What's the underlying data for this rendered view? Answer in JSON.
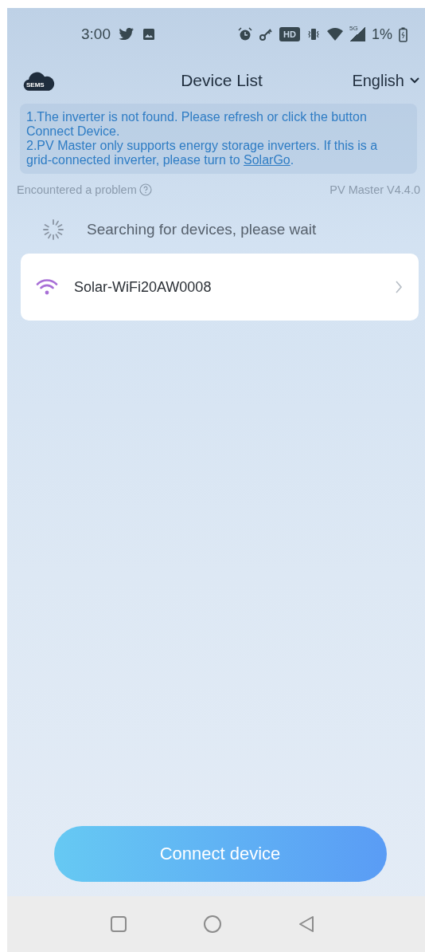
{
  "status_bar": {
    "time": "3:00",
    "hd_badge": "HD",
    "network": "5G",
    "battery": "1%"
  },
  "header": {
    "logo_text": "SEMS",
    "title": "Device List",
    "language": "English"
  },
  "notices": [
    {
      "text": "1.The inverter is not found. Please refresh or click the button Connect Device."
    },
    {
      "text": "2.PV Master only supports energy storage inverters. If this is a grid-connected inverter, please turn to ",
      "link": "SolarGo",
      "suffix": "."
    }
  ],
  "problem_link": "Encountered a problem",
  "version": "PV Master V4.4.0",
  "searching": "Searching for devices, please wait",
  "devices": [
    {
      "name": "Solar-WiFi20AW0008"
    }
  ],
  "connect_button": "Connect device"
}
